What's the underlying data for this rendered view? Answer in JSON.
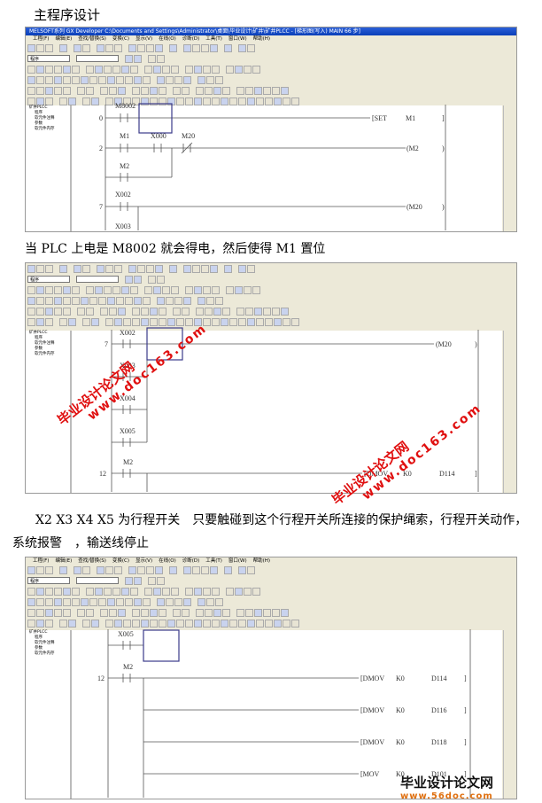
{
  "heading": "主程序设计",
  "caption1": "当 PLC 上电是 M8002 就会得电，然后使得 M1 置位",
  "caption2_line1": "X2 X3 X4 X5 为行程开关　只要触碰到这个行程开关所连接的保护绳索，行程开关动作，",
  "caption2_line2": "系统报警　，输送线停止",
  "app": {
    "title": "MELSOFT系列 GX Developer C:\\Documents and Settings\\Administrator\\桌面\\毕业设计\\矿井\\矿井PLCC - [梯形图(写入)      MAIN      66 步]",
    "menu": [
      "工程(F)",
      "编辑(E)",
      "查找/替换(S)",
      "变换(C)",
      "显示(V)",
      "在线(O)",
      "诊断(D)",
      "工具(T)",
      "窗口(W)",
      "帮助(H)"
    ],
    "combo": "程序",
    "tree": [
      "矿井PLCC",
      "程序",
      "软元件注释",
      "参数",
      "软元件内存"
    ]
  },
  "ladder1": {
    "steps": [
      "0",
      "2",
      "7"
    ],
    "labels": [
      "M8002",
      "M1",
      "X000",
      "M20",
      "M2",
      "X002",
      "X003"
    ],
    "out": [
      "[SET",
      "M1",
      "]",
      "(M2",
      ")",
      "(M20",
      ")"
    ]
  },
  "ladder2": {
    "steps": [
      "7",
      "12"
    ],
    "labels": [
      "X002",
      "X003",
      "X004",
      "X005",
      "M2"
    ],
    "out": [
      "(M20",
      ")",
      "[DMOV",
      "K0",
      "D114",
      "]"
    ]
  },
  "ladder3": {
    "steps": [
      "12"
    ],
    "labels": [
      "X005",
      "M2"
    ],
    "rows": [
      [
        "[DMOV",
        "K0",
        "D114",
        "]"
      ],
      [
        "[DMOV",
        "K0",
        "D116",
        "]"
      ],
      [
        "[DMOV",
        "K0",
        "D118",
        "]"
      ],
      [
        "[MOV",
        "K0",
        "D101",
        "]"
      ]
    ]
  },
  "watermark": {
    "name": "毕业设计论文网",
    "url": "www.doc163.com"
  },
  "logo": {
    "name": "毕业设计论文网",
    "url": "www.56doc.com"
  }
}
